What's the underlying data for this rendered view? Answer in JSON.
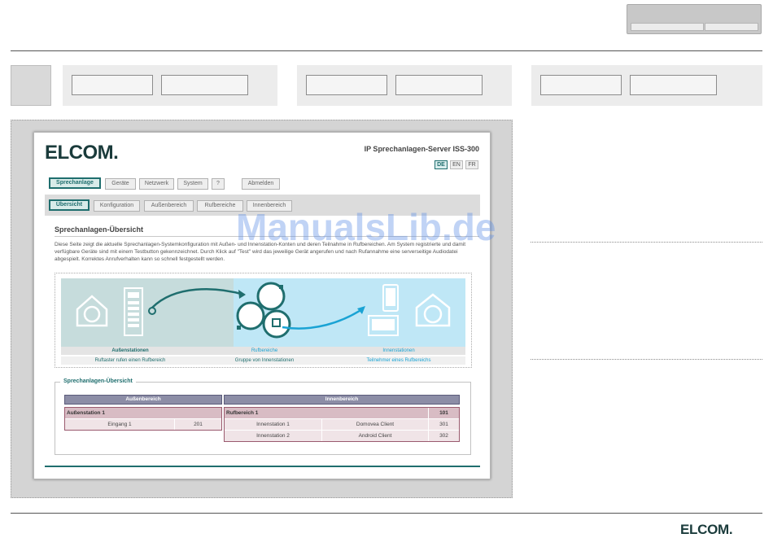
{
  "card": {
    "logo": "ELCOM.",
    "server_title": "IP Sprechanlagen-Server ISS-300",
    "languages": [
      "DE",
      "EN",
      "FR"
    ],
    "main_tabs": [
      "Sprechanlage",
      "Geräte",
      "Netzwerk",
      "System",
      "?",
      "Abmelden"
    ],
    "sub_tabs": [
      "Übersicht",
      "Konfiguration",
      "Außenbereich",
      "Rufbereiche",
      "Innenbereich"
    ],
    "title": "Sprechanlagen-Übersicht",
    "description": "Diese Seite zeigt die aktuelle Sprechanlagen-Systemkonfiguration mit Außen- und Innenstation-Konten und deren Teilnahme in Rufbereichen. Am System registrierte und damit verfügbare Geräte sind mit einem Testbutton gekennzeichnet. Durch Klick auf \"Test\" wird das jeweilige Gerät angerufen und nach Rufannahme eine serverseitige Audiodatei abgespielt. Korrektes Anrufverhalten kann so schnell festgestellt werden.",
    "diagram": {
      "labels": [
        "Außenstationen",
        "Rufbereiche",
        "Innenstationen"
      ],
      "captions": [
        "Ruftaster rufen einen Rufbereich",
        "Gruppe von Innenstationen",
        "Teilnehmer eines Rufbereichs"
      ]
    },
    "overview": {
      "legend": "Sprechanlagen-Übersicht",
      "headers": [
        "Außenbereich",
        "Innenbereich"
      ],
      "outdoor_group": "Außenstation 1",
      "outdoor_rows": [
        {
          "name": "Eingang 1",
          "num": "201"
        }
      ],
      "call_group": "Rufbereich 1",
      "call_group_num": "101",
      "indoor_rows": [
        {
          "name": "Innenstation 1",
          "client": "Domovea Client",
          "num": "301"
        },
        {
          "name": "Innenstation 2",
          "client": "Android Client",
          "num": "302"
        }
      ]
    }
  },
  "watermark": "ManualsLib.de",
  "footer_logo": "ELCOM.",
  "colors": {
    "brand_teal": "#1f6e6e",
    "diagram_green": "#c6dcdc",
    "diagram_blue": "#bfe7f6",
    "table_header": "#8c8da6",
    "table_group": "#d8bcc4"
  }
}
